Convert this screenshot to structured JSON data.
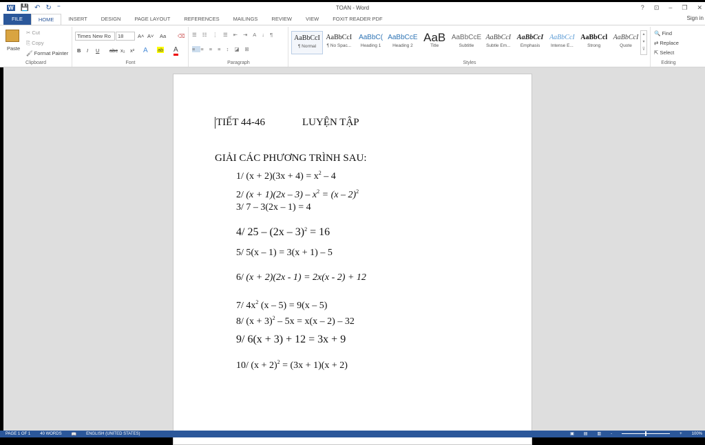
{
  "window": {
    "title": "TOAN - Word",
    "sign_in": "Sign in",
    "help": "?",
    "ribbon_display": "⊡",
    "minimize": "–",
    "restore": "❐",
    "close": "✕"
  },
  "quick_access": {
    "word": "W",
    "save": "💾",
    "undo": "↶",
    "redo": "↻",
    "customize": "⁼"
  },
  "tabs": [
    {
      "label": "FILE"
    },
    {
      "label": "HOME"
    },
    {
      "label": "INSERT"
    },
    {
      "label": "DESIGN"
    },
    {
      "label": "PAGE LAYOUT"
    },
    {
      "label": "REFERENCES"
    },
    {
      "label": "MAILINGS"
    },
    {
      "label": "REVIEW"
    },
    {
      "label": "VIEW"
    },
    {
      "label": "FOXIT READER PDF"
    }
  ],
  "clipboard": {
    "label": "Clipboard",
    "paste": "Paste",
    "cut": "Cut",
    "copy": "Copy",
    "format_painter": "Format Painter"
  },
  "font": {
    "label": "Font",
    "name": "Times New Ro",
    "size": "18",
    "grow": "A˄",
    "shrink": "A˅",
    "case": "Aa",
    "row2": [
      "B",
      "I",
      "U",
      "abc",
      "x₂",
      "x²"
    ],
    "effects": "A",
    "highlight": "ab",
    "color": "A"
  },
  "paragraph": {
    "label": "Paragraph",
    "row1": [
      "☰",
      "☷",
      "⋮☰",
      "⇤",
      "⇥",
      "A↓",
      "¶"
    ],
    "row2": [
      "≡",
      "≡",
      "≡",
      "≡",
      "↕",
      "◪",
      "⊞"
    ]
  },
  "styles": {
    "label": "Styles",
    "items": [
      {
        "sample": "AaBbCcI",
        "name": "¶ Normal",
        "color": "#222"
      },
      {
        "sample": "AaBbCcI",
        "name": "¶ No Spac...",
        "color": "#222"
      },
      {
        "sample": "AaBbC(",
        "name": "Heading 1",
        "color": "#2e74b5"
      },
      {
        "sample": "AaBbCcE",
        "name": "Heading 2",
        "color": "#2e74b5"
      },
      {
        "sample": "AaB",
        "name": "Title",
        "color": "#222"
      },
      {
        "sample": "AaBbCcE",
        "name": "Subtitle",
        "color": "#666"
      },
      {
        "sample": "AaBbCcI",
        "name": "Subtle Em...",
        "color": "#444"
      },
      {
        "sample": "AaBbCcI",
        "name": "Emphasis",
        "color": "#222"
      },
      {
        "sample": "AaBbCcI",
        "name": "Intense E...",
        "color": "#5b9bd5"
      },
      {
        "sample": "AaBbCcl",
        "name": "Strong",
        "color": "#111"
      },
      {
        "sample": "AaBbCcI",
        "name": "Quote",
        "color": "#444"
      }
    ]
  },
  "editing": {
    "label": "Editing",
    "find": "Find",
    "replace": "Replace",
    "select": "Select"
  },
  "document": {
    "heading_left": "TIẾT 44-46",
    "heading_right": "LUYỆN TẬP",
    "subheading": "GIẢI CÁC PHƯƠNG TRÌNH SAU:",
    "equations": [
      {
        "label": "1/",
        "parts": [
          {
            "t": "(x + 2)(3x + 4) = x"
          },
          {
            "t": "2",
            "sup": true
          },
          {
            "t": " – 4"
          }
        ]
      },
      {
        "label": "2/",
        "parts": [
          {
            "t": "(x + 1)(2x – 3) – x",
            "i": true
          },
          {
            "t": "2",
            "sup": true
          },
          {
            "t": " = (x – 2)",
            "i": true
          },
          {
            "t": "2",
            "sup": true
          }
        ]
      },
      {
        "label": "3/",
        "parts": [
          {
            "t": "7 – 3(2x – 1) = 4"
          }
        ]
      },
      {
        "label": "4/",
        "parts": [
          {
            "t": "25 – (2x – 3)"
          },
          {
            "t": "2",
            "sup": true
          },
          {
            "t": " = 16"
          }
        ]
      },
      {
        "label": "5/",
        "parts": [
          {
            "t": "5(x – 1) = 3(x + 1) – 5"
          }
        ]
      },
      {
        "label": "6/",
        "parts": [
          {
            "t": "(x + 2)(2x - 1) = 2x(x - 2) + 12",
            "i": true
          }
        ]
      },
      {
        "label": "7/",
        "parts": [
          {
            "t": "4x"
          },
          {
            "t": "2",
            "sup": true
          },
          {
            "t": " (x – 5) = 9(x – 5)"
          }
        ]
      },
      {
        "label": "8/",
        "parts": [
          {
            "t": "(x + 3)"
          },
          {
            "t": "2",
            "sup": true
          },
          {
            "t": " – 5x = x(x – 2) – 32"
          }
        ]
      },
      {
        "label": "9/",
        "parts": [
          {
            "t": "6(x + 3) + 12 = 3x + 9"
          }
        ]
      },
      {
        "label": "10/",
        "parts": [
          {
            "t": "(x + 2)"
          },
          {
            "t": "2",
            "sup": true
          },
          {
            "t": " = (3x + 1)(x + 2)"
          }
        ]
      }
    ]
  },
  "status": {
    "page": "PAGE 1 OF 1",
    "words": "40 WORDS",
    "proof": "📖",
    "language": "ENGLISH (UNITED STATES)",
    "zoom": "100%",
    "zoom_out": "-",
    "zoom_in": "+"
  },
  "colors": {
    "accent": "#2b579a"
  }
}
